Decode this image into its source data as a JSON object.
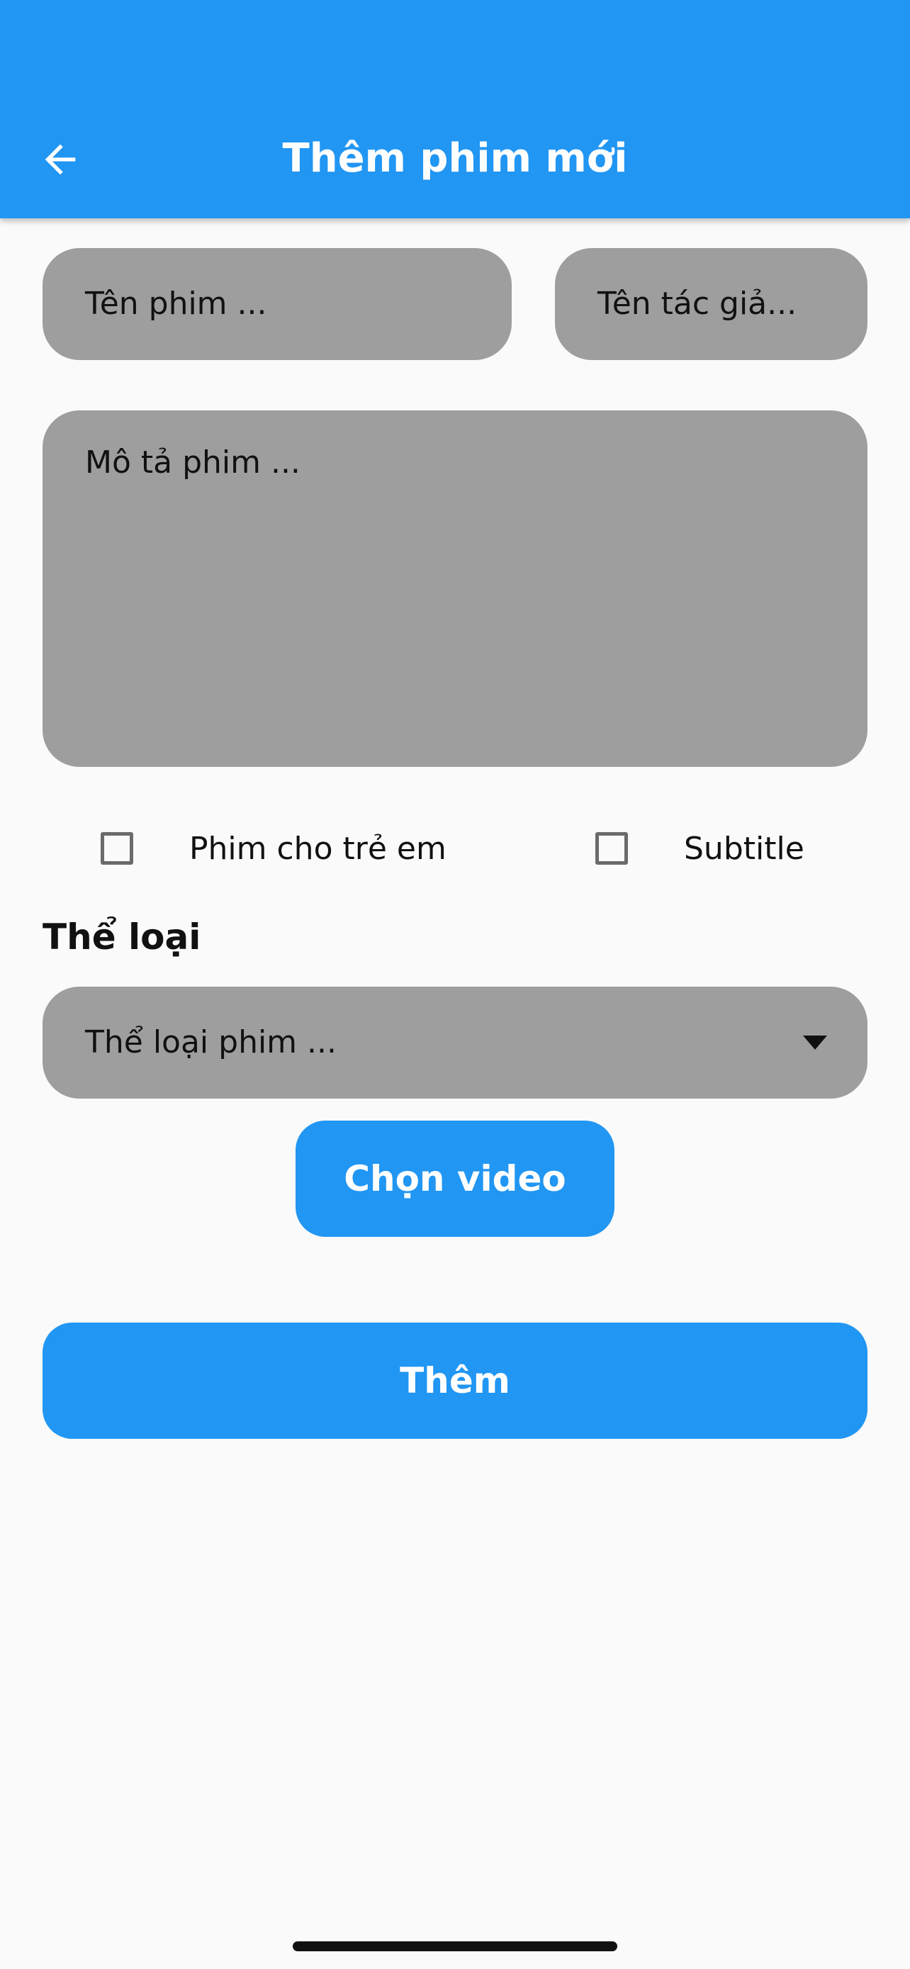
{
  "app_bar": {
    "title": "Thêm phim mới",
    "back_icon": "arrow-left-icon",
    "color": "#2196f3"
  },
  "form": {
    "movie_name_placeholder": "Tên phim ...",
    "author_placeholder": "Tên tác giả...",
    "description_placeholder": "Mô tả phim ...",
    "kids_checkbox": {
      "label": "Phim cho trẻ em",
      "checked": false
    },
    "subtitle_checkbox": {
      "label": "Subtitle",
      "checked": false
    },
    "genre_section_title": "Thể loại",
    "genre_select": {
      "placeholder": "Thể loại phim ...",
      "icon": "caret-down-icon"
    },
    "choose_video_label": "Chọn video",
    "submit_label": "Thêm"
  }
}
